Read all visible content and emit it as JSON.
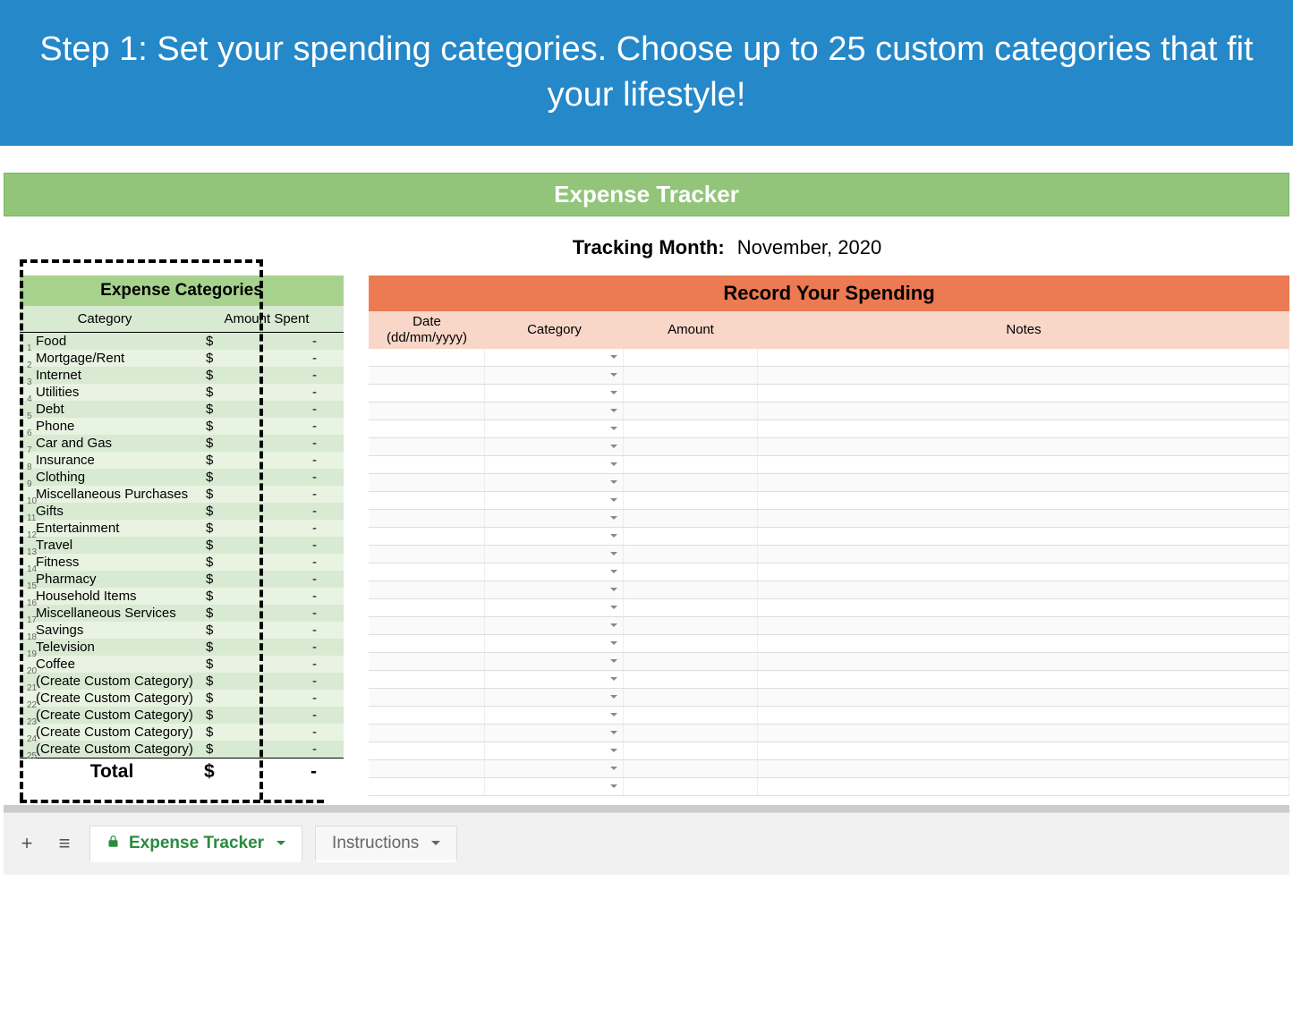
{
  "promo": {
    "text": "Step 1: Set your spending categories. Choose up to 25 custom categories that fit your lifestyle!"
  },
  "header": {
    "title": "Expense Tracker",
    "tracking_label": "Tracking Month:",
    "tracking_value": "November, 2020"
  },
  "categories_panel": {
    "title": "Expense Categories",
    "col_category": "Category",
    "col_amount": "Amount Spent",
    "rows": [
      {
        "n": "1",
        "name": "Food",
        "cur": "$",
        "val": "-"
      },
      {
        "n": "2",
        "name": "Mortgage/Rent",
        "cur": "$",
        "val": "-"
      },
      {
        "n": "3",
        "name": "Internet",
        "cur": "$",
        "val": "-"
      },
      {
        "n": "4",
        "name": "Utilities",
        "cur": "$",
        "val": "-"
      },
      {
        "n": "5",
        "name": "Debt",
        "cur": "$",
        "val": "-"
      },
      {
        "n": "6",
        "name": "Phone",
        "cur": "$",
        "val": "-"
      },
      {
        "n": "7",
        "name": "Car and Gas",
        "cur": "$",
        "val": "-"
      },
      {
        "n": "8",
        "name": "Insurance",
        "cur": "$",
        "val": "-"
      },
      {
        "n": "9",
        "name": "Clothing",
        "cur": "$",
        "val": "-"
      },
      {
        "n": "10",
        "name": "Miscellaneous Purchases",
        "cur": "$",
        "val": "-"
      },
      {
        "n": "11",
        "name": "Gifts",
        "cur": "$",
        "val": "-"
      },
      {
        "n": "12",
        "name": "Entertainment",
        "cur": "$",
        "val": "-"
      },
      {
        "n": "13",
        "name": "Travel",
        "cur": "$",
        "val": "-"
      },
      {
        "n": "14",
        "name": "Fitness",
        "cur": "$",
        "val": "-"
      },
      {
        "n": "15",
        "name": "Pharmacy",
        "cur": "$",
        "val": "-"
      },
      {
        "n": "16",
        "name": "Household Items",
        "cur": "$",
        "val": "-"
      },
      {
        "n": "17",
        "name": "Miscellaneous Services",
        "cur": "$",
        "val": "-"
      },
      {
        "n": "18",
        "name": "Savings",
        "cur": "$",
        "val": "-"
      },
      {
        "n": "19",
        "name": "Television",
        "cur": "$",
        "val": "-"
      },
      {
        "n": "20",
        "name": "Coffee",
        "cur": "$",
        "val": "-"
      },
      {
        "n": "21",
        "name": "(Create Custom Category)",
        "cur": "$",
        "val": "-"
      },
      {
        "n": "22",
        "name": "(Create Custom Category)",
        "cur": "$",
        "val": "-"
      },
      {
        "n": "23",
        "name": "(Create Custom Category)",
        "cur": "$",
        "val": "-"
      },
      {
        "n": "24",
        "name": "(Create Custom Category)",
        "cur": "$",
        "val": "-"
      },
      {
        "n": "25",
        "name": "(Create Custom Category)",
        "cur": "$",
        "val": "-"
      }
    ],
    "total_label": "Total",
    "total_cur": "$",
    "total_val": "-"
  },
  "spending_panel": {
    "title": "Record Your Spending",
    "col_date_l1": "Date",
    "col_date_l2": "(dd/mm/yyyy)",
    "col_category": "Category",
    "col_amount": "Amount",
    "col_notes": "Notes",
    "row_count": 25
  },
  "tabs": {
    "active": "Expense Tracker",
    "inactive": "Instructions"
  }
}
